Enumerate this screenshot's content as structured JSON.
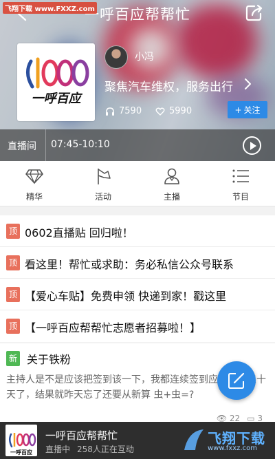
{
  "watermark_top": "飞翔下载 www.FXXZ.com",
  "nav": {
    "title": "一呼百应帮帮忙"
  },
  "station": {
    "logo_text": "一呼百应",
    "logo_mark": "1000",
    "host": "小冯",
    "description": "聚焦汽车维权，服务出行",
    "listens": "7590",
    "likes": "5990",
    "follow_label": "关注"
  },
  "live": {
    "label": "直播间",
    "time": "07:45-10:10"
  },
  "tabs": [
    {
      "label": "精华",
      "icon": "diamond-icon"
    },
    {
      "label": "活动",
      "icon": "flag-icon"
    },
    {
      "label": "主播",
      "icon": "user-icon"
    },
    {
      "label": "节目",
      "icon": "list-icon"
    }
  ],
  "pinned": [
    {
      "badge": "顶",
      "title": "0602直播贴 回归啦！"
    },
    {
      "badge": "顶",
      "title": "看这里！帮忙或求助：务必私信公众号联系"
    },
    {
      "badge": "顶",
      "title": "【爱心车贴】免费申领 快递到家！戳这里"
    },
    {
      "badge": "顶",
      "title": "【一呼百应帮帮忙志愿者招募啦！】"
    }
  ],
  "post": {
    "badge": "新",
    "title": "关于铁粉",
    "body": "主持人是不是应该把签到该一下，我都连续签到应该有快三十天了，结果就昨天忘了还要从新算 虫+虫=?",
    "views": "22",
    "comments": "3"
  },
  "player": {
    "title": "一呼百应帮帮忙",
    "status": "直播中",
    "listeners": "258人正在互动"
  },
  "watermark_bottom": {
    "brand": "飞翔下载",
    "url": "www.fxxz.com"
  },
  "colors": {
    "accent": "#2d8ae6",
    "pin_badge": "#e8705c",
    "new_badge": "#4fb854"
  }
}
